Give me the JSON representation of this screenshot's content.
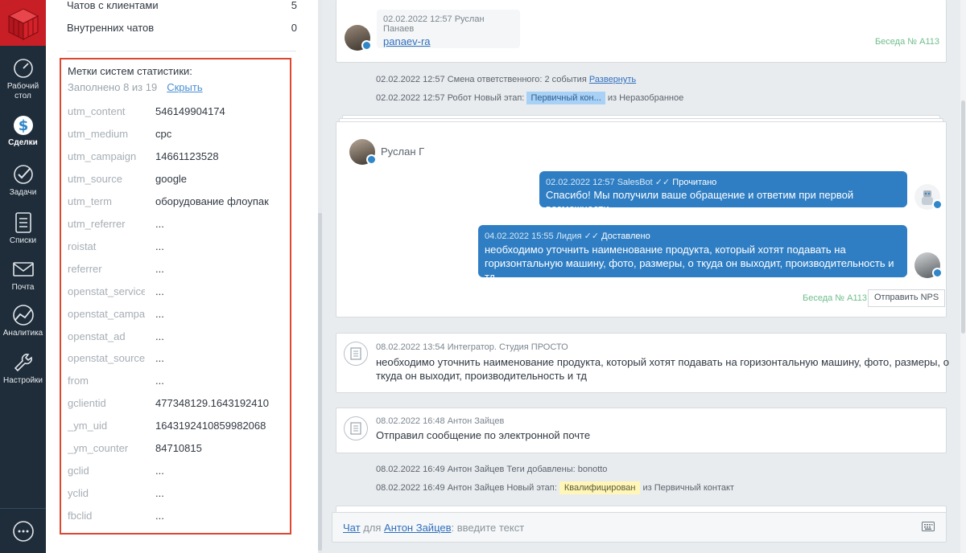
{
  "nav": {
    "items": [
      {
        "label": "Рабочий стол",
        "icon": "dashboard-icon"
      },
      {
        "label": "Сделки",
        "icon": "deals-icon"
      },
      {
        "label": "Задачи",
        "icon": "tasks-icon"
      },
      {
        "label": "Списки",
        "icon": "lists-icon"
      },
      {
        "label": "Почта",
        "icon": "mail-icon"
      },
      {
        "label": "Аналитика",
        "icon": "analytics-icon"
      },
      {
        "label": "Настройки",
        "icon": "settings-icon"
      }
    ]
  },
  "left": {
    "client_chats_label": "Чатов с клиентами",
    "client_chats_value": "5",
    "internal_chats_label": "Внутренних чатов",
    "internal_chats_value": "0",
    "stats": {
      "title": "Метки систем статистики:",
      "filled": "Заполнено 8 из 19",
      "hide": "Скрыть",
      "rows": [
        {
          "k": "utm_content",
          "v": "546149904174"
        },
        {
          "k": "utm_medium",
          "v": "cpc"
        },
        {
          "k": "utm_campaign",
          "v": "14661123528"
        },
        {
          "k": "utm_source",
          "v": "google"
        },
        {
          "k": "utm_term",
          "v": "оборудование флоупак"
        },
        {
          "k": "utm_referrer",
          "v": "..."
        },
        {
          "k": "roistat",
          "v": "..."
        },
        {
          "k": "referrer",
          "v": "..."
        },
        {
          "k": "openstat_service",
          "v": "..."
        },
        {
          "k": "openstat_campaign",
          "v": "..."
        },
        {
          "k": "openstat_ad",
          "v": "..."
        },
        {
          "k": "openstat_source",
          "v": "..."
        },
        {
          "k": "from",
          "v": "..."
        },
        {
          "k": "gclientid",
          "v": "477348129.1643192410"
        },
        {
          "k": "_ym_uid",
          "v": "1643192410859982068"
        },
        {
          "k": "_ym_counter",
          "v": "84710815"
        },
        {
          "k": "gclid",
          "v": "..."
        },
        {
          "k": "yclid",
          "v": "..."
        },
        {
          "k": "fbclid",
          "v": "..."
        }
      ]
    }
  },
  "feed": {
    "card1": {
      "header": "02.02.2022 12:57 Руслан Панаев",
      "link": "panaev-ra",
      "conversation": "Беседа № А113"
    },
    "event1": {
      "text": "02.02.2022 12:57 Смена ответственного: 2 события",
      "link": "Развернуть"
    },
    "event2": {
      "text": "02.02.2022 12:57 Робот Новый этап:",
      "tag": "Первичный кон...",
      "suffix": "из Неразобранное"
    },
    "chat": {
      "author": "Руслан Г",
      "msg1": {
        "header": "02.02.2022 12:57 SalesBot",
        "status": "Прочитано",
        "text": "Спасибо! Мы получили ваше обращение и ответим при первой возможности"
      },
      "msg2": {
        "header": "04.02.2022 15:55 Лидия",
        "status": "Доставлено",
        "line1": "необходимо уточнить наименование продукта, который хотят подавать на",
        "line2": "горизонтальную машину, фото, размеры, о ткуда он выходит, производительность и тд"
      },
      "conversation": "Беседа № А113",
      "nps_button": "Отправить NPS"
    },
    "note1": {
      "header": "08.02.2022 13:54 Интегратор. Студия ПРОСТО",
      "line1": "необходимо уточнить наименование продукта, который хотят подавать на горизонтальную машину, фото, размеры, о",
      "line2": "ткуда он выходит, производительность и тд"
    },
    "note2": {
      "header": "08.02.2022 16:48 Антон Зайцев",
      "text": "Отправил сообщение по электронной почте"
    },
    "event3": {
      "text": "08.02.2022 16:49 Антон Зайцев Теги добавлены: bonotto"
    },
    "event4": {
      "text": "08.02.2022 16:49 Антон Зайцев Новый этап:",
      "tag": "Квалифицирован",
      "suffix": "из Первичный контакт"
    }
  },
  "input": {
    "chat_link": "Чат",
    "for": "для",
    "user_link": "Антон Зайцев",
    "placeholder": ": введите текст"
  }
}
